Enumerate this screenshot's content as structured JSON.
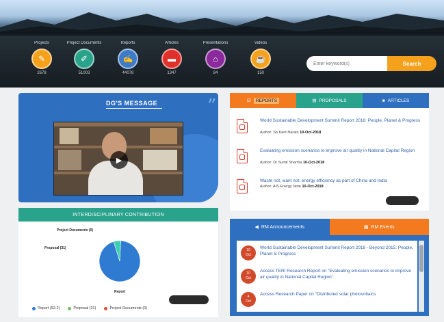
{
  "nav": {
    "items": [
      {
        "label": "Projects",
        "count": "2678",
        "color": "#f5a11c",
        "icon": "document-icon",
        "glyph": "✎"
      },
      {
        "label": "Project Documents",
        "count": "51003",
        "color": "#2aa38c",
        "icon": "pencil-icon",
        "glyph": "✐"
      },
      {
        "label": "Reports",
        "count": "44078",
        "color": "#3e7bc7",
        "icon": "edit-icon",
        "glyph": "✍"
      },
      {
        "label": "Articles",
        "count": "1347",
        "color": "#e0302b",
        "icon": "article-icon",
        "glyph": "▬"
      },
      {
        "label": "Presentations",
        "count": "84",
        "color": "#8a2a9c",
        "icon": "presentation-icon",
        "glyph": "⌂"
      },
      {
        "label": "Videos",
        "count": "150",
        "color": "#f5a11c",
        "icon": "video-icon",
        "glyph": "☕"
      }
    ]
  },
  "search": {
    "placeholder": "Enter keyword(s)",
    "button_label": "Search"
  },
  "dg": {
    "title": "DG'S MESSAGE",
    "quote": "”"
  },
  "contribution": {
    "heading": "INTERDISCIPLINARY CONTRIBUTION",
    "view_more": "",
    "legend": [
      {
        "label": "Report (52.2)",
        "color": "#2f7bd2"
      },
      {
        "label": "Proposal (31)",
        "color": "#6cc06c"
      },
      {
        "label": "Project Documents (0)",
        "color": "#e04a3a"
      }
    ]
  },
  "chart_data": {
    "type": "pie",
    "slices": [
      {
        "name": "Report",
        "value": 94.4,
        "color": "#2f7bd2"
      },
      {
        "name": "Proposal",
        "value": 5.6,
        "color": "#3ecfb0"
      },
      {
        "name": "Project Documents",
        "value": 0,
        "color": "#e04a3a"
      }
    ],
    "labels": [
      "Project Documents (0)",
      "Proposal (31)",
      "Report"
    ]
  },
  "tabs": {
    "reports": "REPORTS",
    "proposals": "PROPOSALS",
    "articles": "ARTICLES"
  },
  "reports": [
    {
      "title": "World Sustainable Development Summit Report 2018: People, Planet & Progress",
      "author": "Author: Sb Kant Narain",
      "date": "10-Oct-2018"
    },
    {
      "title": "Evaluating emission scenarios to improve air quality in National Capital Region",
      "author": "Author: Dr Sumit Sharma",
      "date": "10-Oct-2018"
    },
    {
      "title": "Waste not, want not: energy efficiency as part of China and India",
      "author": "Author: AIS Energy Note",
      "date": "10-Oct-2018"
    }
  ],
  "reports_more": "",
  "announcements": {
    "tab_announcements": "RM Announcements",
    "tab_events": "RM Events",
    "items": [
      {
        "day": "10",
        "month": "Oct",
        "text": "World Sustainable Development Summit Report 2018 - Beyond 2015: People, Planet & Progress"
      },
      {
        "day": "10",
        "month": "Oct",
        "text": "Access TERI Research Report on “Evaluating emission scenarios to improve air quality in National Capital Region”"
      },
      {
        "day": "4",
        "month": "Oct",
        "text": "Access Research Paper on “Distributed solar photovoltaics"
      }
    ]
  }
}
